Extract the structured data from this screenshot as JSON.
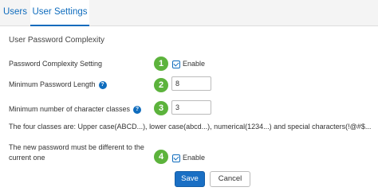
{
  "tabs": {
    "users": "Users",
    "user_settings": "User Settings"
  },
  "section_title": "User Password Complexity",
  "fields": {
    "complexity_setting": {
      "label": "Password Complexity Setting",
      "badge": "1",
      "checkbox_label": "Enable",
      "checked": true
    },
    "min_length": {
      "label": "Minimum Password Length",
      "badge": "2",
      "value": "8"
    },
    "min_classes": {
      "label": "Minimum number of character classes",
      "badge": "3",
      "value": "3"
    },
    "classes_info": "The four classes are: Upper case(ABCD...), lower case(abcd...), numerical(1234...) and special characters(!@#$...",
    "different_password": {
      "label_line1": "The new password must be different to the",
      "label_line2": "current one",
      "badge": "4",
      "checkbox_label": "Enable",
      "checked": true
    }
  },
  "help_icon_glyph": "?",
  "buttons": {
    "save": "Save",
    "cancel": "Cancel"
  },
  "colors": {
    "accent": "#0f6cbd",
    "badge": "#5cb33c",
    "save_button": "#1a6fc4"
  }
}
